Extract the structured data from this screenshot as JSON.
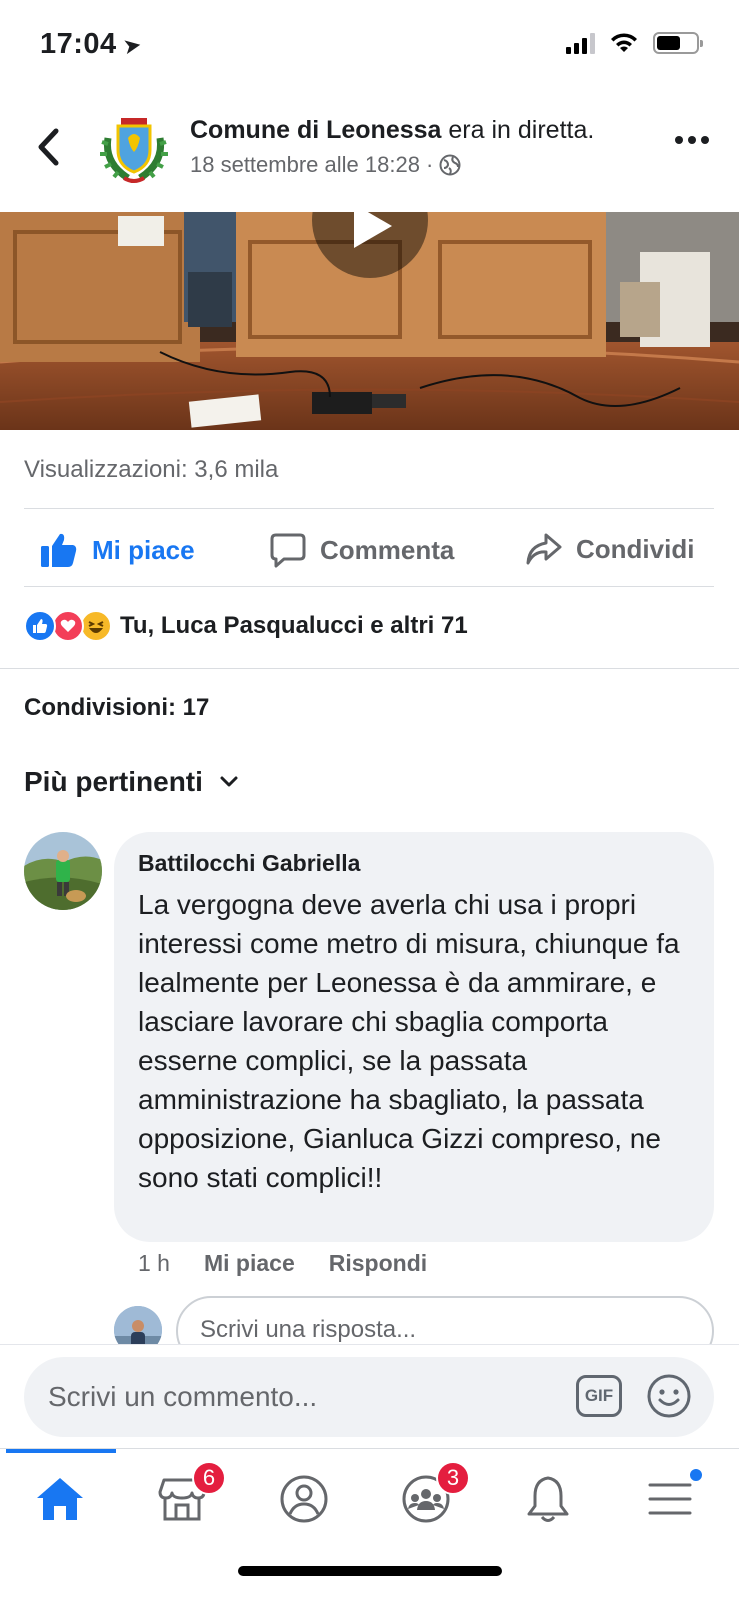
{
  "status_bar": {
    "time": "17:04",
    "location_glyph": "➤"
  },
  "post": {
    "page_name": "Comune di Leonessa",
    "action_text": "era in diretta.",
    "date": "18 settembre alle 18:28",
    "separator": "·",
    "privacy_icon": "globe-icon"
  },
  "stats": {
    "views": "Visualizzazioni: 3,6 mila",
    "reactions_text": "Tu, Luca Pasqualucci e altri 71",
    "shares": "Condivisioni: 17"
  },
  "actions": {
    "like": "Mi piace",
    "comment": "Commenta",
    "share": "Condividi"
  },
  "comments": {
    "sort_label": "Più pertinenti",
    "items": [
      {
        "author": "Battilocchi Gabriella",
        "text": "La vergogna deve averla chi usa i propri interessi come metro di misura, chiunque fa lealmente per Leonessa è da ammirare, e lasciare lavorare chi sbaglia comporta esserne complici, se la passata amministrazione ha sbagliato, la passata opposizione, Gianluca Gizzi compreso, ne sono stati complici!!",
        "time": "1 h",
        "like_label": "Mi piace",
        "reply_label": "Rispondi"
      }
    ],
    "reply_placeholder": "Scrivi una risposta..."
  },
  "composer": {
    "placeholder": "Scrivi un commento...",
    "gif_label": "GIF"
  },
  "tab_bar": {
    "marketplace_badge": "6",
    "groups_badge": "3"
  },
  "colors": {
    "accent": "#1877f2",
    "badge": "#e41e3f",
    "muted_text": "#65676b",
    "bubble_bg": "#f0f2f5"
  }
}
